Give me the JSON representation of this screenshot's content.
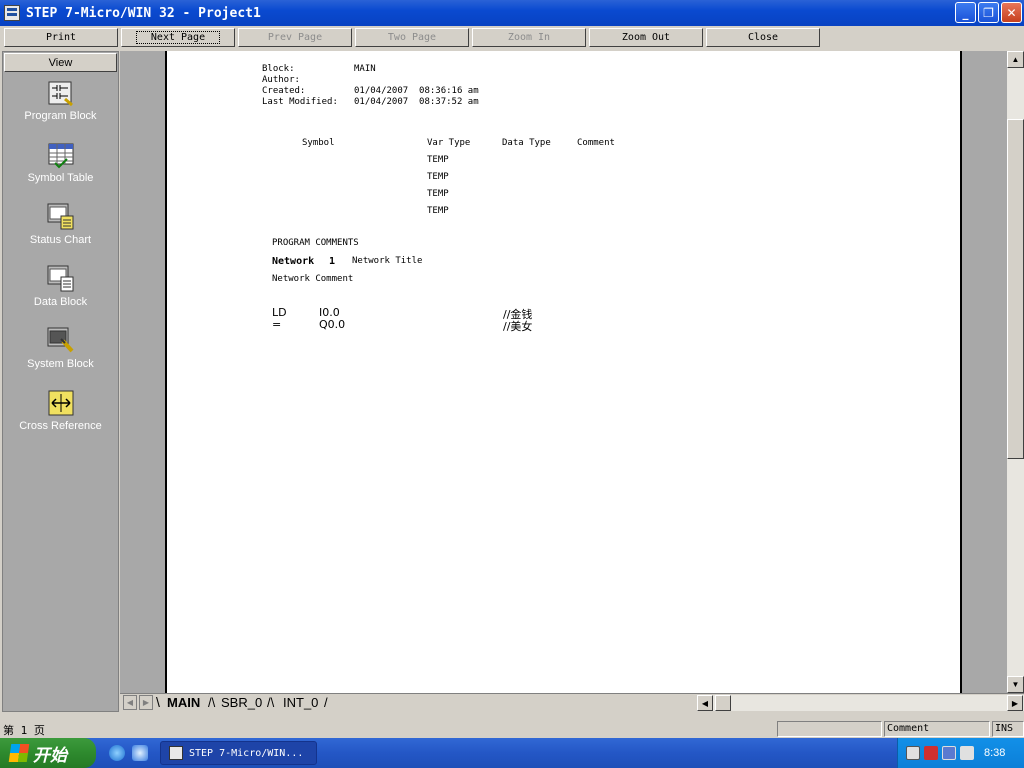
{
  "window": {
    "title": "STEP 7-Micro/WIN 32 - Project1"
  },
  "toolbar": {
    "print": "Print",
    "next_page": "Next Page",
    "prev_page": "Prev Page",
    "two_page": "Two Page",
    "zoom_in": "Zoom In",
    "zoom_out": "Zoom Out",
    "close": "Close"
  },
  "sidebar": {
    "header": "View",
    "items": [
      {
        "label": "Program Block",
        "icon": "program-block-icon"
      },
      {
        "label": "Symbol Table",
        "icon": "symbol-table-icon"
      },
      {
        "label": "Status Chart",
        "icon": "status-chart-icon"
      },
      {
        "label": "Data Block",
        "icon": "data-block-icon"
      },
      {
        "label": "System Block",
        "icon": "system-block-icon"
      },
      {
        "label": "Cross Reference",
        "icon": "cross-reference-icon"
      }
    ]
  },
  "document": {
    "block_label": "Block:",
    "block_value": "MAIN",
    "author_label": "Author:",
    "created_label": "Created:",
    "created_value": "01/04/2007  08:36:16 am",
    "modified_label": "Last Modified:",
    "modified_value": "01/04/2007  08:37:52 am",
    "columns": {
      "symbol": "Symbol",
      "var_type": "Var Type",
      "data_type": "Data Type",
      "comment": "Comment"
    },
    "var_types": [
      "TEMP",
      "TEMP",
      "TEMP",
      "TEMP"
    ],
    "program_comments": "PROGRAM COMMENTS",
    "network_label": "Network",
    "network_number": "1",
    "network_title": "Network Title",
    "network_comment": "Network Comment",
    "code": [
      {
        "op": "LD",
        "operand": "I0.0",
        "comment": "//金钱"
      },
      {
        "op": "=",
        "operand": "Q0.0",
        "comment": "//美女"
      }
    ]
  },
  "tabs": [
    "MAIN",
    "SBR_0",
    "INT_0"
  ],
  "status": {
    "page": "第 1 页",
    "field": "Comment",
    "mode": "INS"
  },
  "taskbar": {
    "start": "开始",
    "task": "STEP 7-Micro/WIN...",
    "clock": "8:38"
  }
}
